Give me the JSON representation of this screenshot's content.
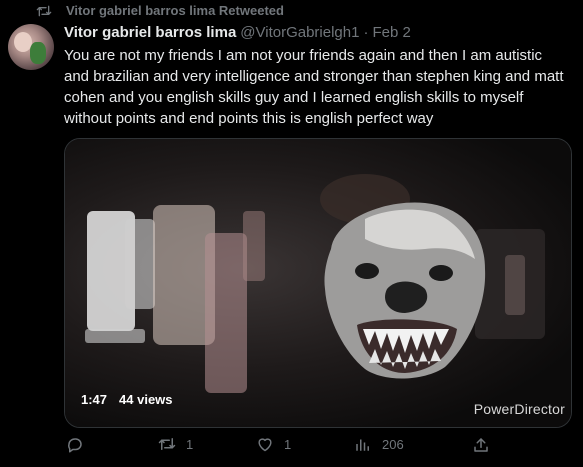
{
  "retweet_banner": {
    "text": "Vitor gabriel barros lima Retweeted"
  },
  "tweet": {
    "author_name": "Vitor gabriel barros lima",
    "author_handle": "@VitorGabrielgh1",
    "separator": "·",
    "date": "Feb 2",
    "text": "You are not my friends I am not your friends again and then I am autistic and brazilian and very intelligence and stronger than stephen king and matt cohen and you english skills guy and I learned english skills to myself without points and end points this is english perfect way"
  },
  "media": {
    "duration": "1:47",
    "views": "44 views",
    "watermark": "PowerDirector"
  },
  "actions": {
    "replies": "",
    "retweets": "1",
    "likes": "1",
    "views": "206"
  },
  "colors": {
    "background": "#000000",
    "text_primary": "#e7e9ea",
    "text_secondary": "#71767b",
    "border": "#2f3336"
  }
}
